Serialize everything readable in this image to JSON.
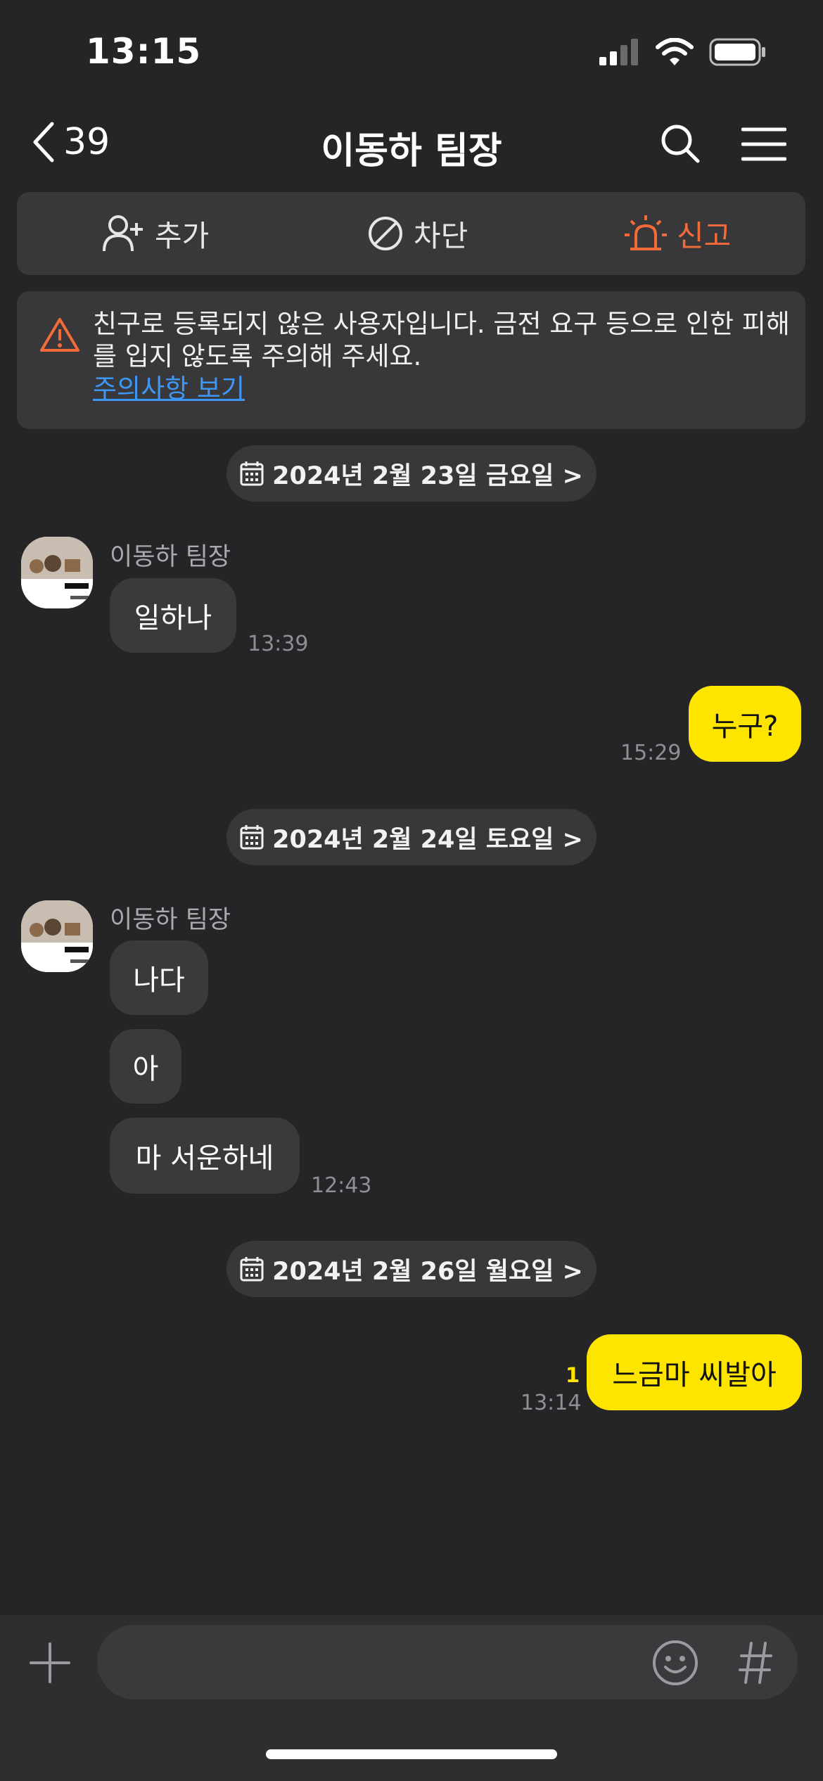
{
  "status_bar": {
    "time": "13:15"
  },
  "nav": {
    "back_count": "39",
    "title": "이동하 팀장"
  },
  "actions": {
    "add_label": "추가",
    "block_label": "차단",
    "report_label": "신고"
  },
  "warning": {
    "text": "친구로 등록되지 않은 사용자입니다. 금전 요구 등으로 인한 피해를 입지 않도록 주의해 주세요.",
    "link": "주의사항 보기"
  },
  "dates": [
    "2024년 2월 23일 금요일 >",
    "2024년 2월 24일 토요일 >",
    "2024년 2월 26일 월요일 >"
  ],
  "messages": {
    "sender_name": "이동하 팀장",
    "m1": {
      "text": "일하나",
      "time": "13:39"
    },
    "m2": {
      "text": "누구?",
      "time": "15:29"
    },
    "m3": {
      "text": "나다"
    },
    "m4": {
      "text": "아"
    },
    "m5": {
      "text": "마 서운하네",
      "time": "12:43"
    },
    "m6": {
      "text": "느금마 씨발아",
      "time": "13:14",
      "unread": "1"
    }
  },
  "colors": {
    "accent_yellow": "#fee500",
    "report_orange": "#f26b38",
    "link_blue": "#3e97f5",
    "background": "#252527"
  }
}
